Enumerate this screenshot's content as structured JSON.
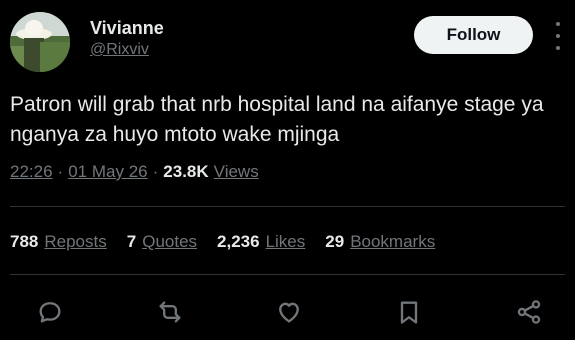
{
  "user": {
    "name": "Vivianne",
    "handle": "@Rixviv",
    "follow_label": "Follow"
  },
  "tweet": {
    "text": "Patron will grab that nrb hospital land na aifanye stage ya nganya za huyo mtoto wake mjinga",
    "time": "22:26",
    "date": "01 May 26",
    "views_count": "23.8K",
    "views_label": "Views"
  },
  "stats": [
    {
      "count": "788",
      "label": "Reposts"
    },
    {
      "count": "7",
      "label": "Quotes"
    },
    {
      "count": "2,236",
      "label": "Likes"
    },
    {
      "count": "29",
      "label": "Bookmarks"
    }
  ],
  "actions": [
    "reply-icon",
    "repost-icon",
    "like-icon",
    "bookmark-icon",
    "share-icon"
  ],
  "colors": {
    "background": "#000000",
    "text_primary": "#e7e9ea",
    "text_secondary": "#71767b",
    "follow_bg": "#eff3f4",
    "divider": "#2f3336"
  }
}
